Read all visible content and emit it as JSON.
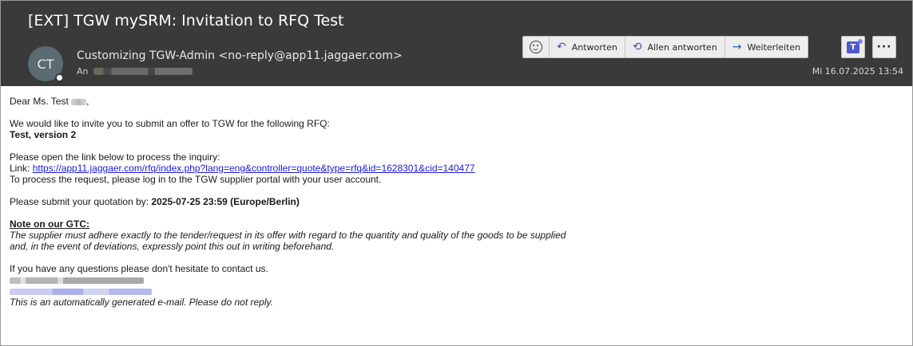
{
  "email": {
    "subject": "[EXT] TGW mySRM: Invitation to RFQ Test",
    "avatar_initials": "CT",
    "sender": "Customizing TGW-Admin <no-reply@app11.jaggaer.com>",
    "to_label": "An",
    "date": "Mi 16.07.2025 13:54"
  },
  "toolbar": {
    "reply_label": "Antworten",
    "reply_all_label": "Allen antworten",
    "forward_label": "Weiterleiten",
    "more_label": "···",
    "icons": [
      "smiley-icon",
      "reply-icon",
      "reply-all-icon",
      "forward-icon",
      "teams-icon",
      "more-icon"
    ]
  },
  "body": {
    "greeting": "Dear Ms. Test",
    "greeting_suffix": ",",
    "invite_line": "We would like to invite you to submit an offer to TGW for the following RFQ:",
    "rfq_name": "Test, version 2",
    "open_link_line": "Please open the link below to process the inquiry:",
    "link_label": "Link: ",
    "link_url": "https://app11.jaggaer.com/rfq/index.php?lang=eng&controller=quote&type=rfq&id=1628301&cid=140477",
    "login_line": "To process the request, please log in to the TGW supplier portal with your user account.",
    "submit_prefix": "Please submit your quotation by: ",
    "deadline": "2025-07-25 23:59 (Europe/Berlin)",
    "gtc_heading": "Note on our GTC:",
    "gtc_line_1": "The supplier must adhere exactly to the tender/request in its offer with regard to the quantity and quality of the goods to be supplied",
    "gtc_line_2": "and, in the event of deviations, expressly point this out in writing beforehand.",
    "questions_line": "If you have any questions please don't hesitate to contact us.",
    "auto_line": "This is an automatically generated e-mail. Please do not reply."
  }
}
